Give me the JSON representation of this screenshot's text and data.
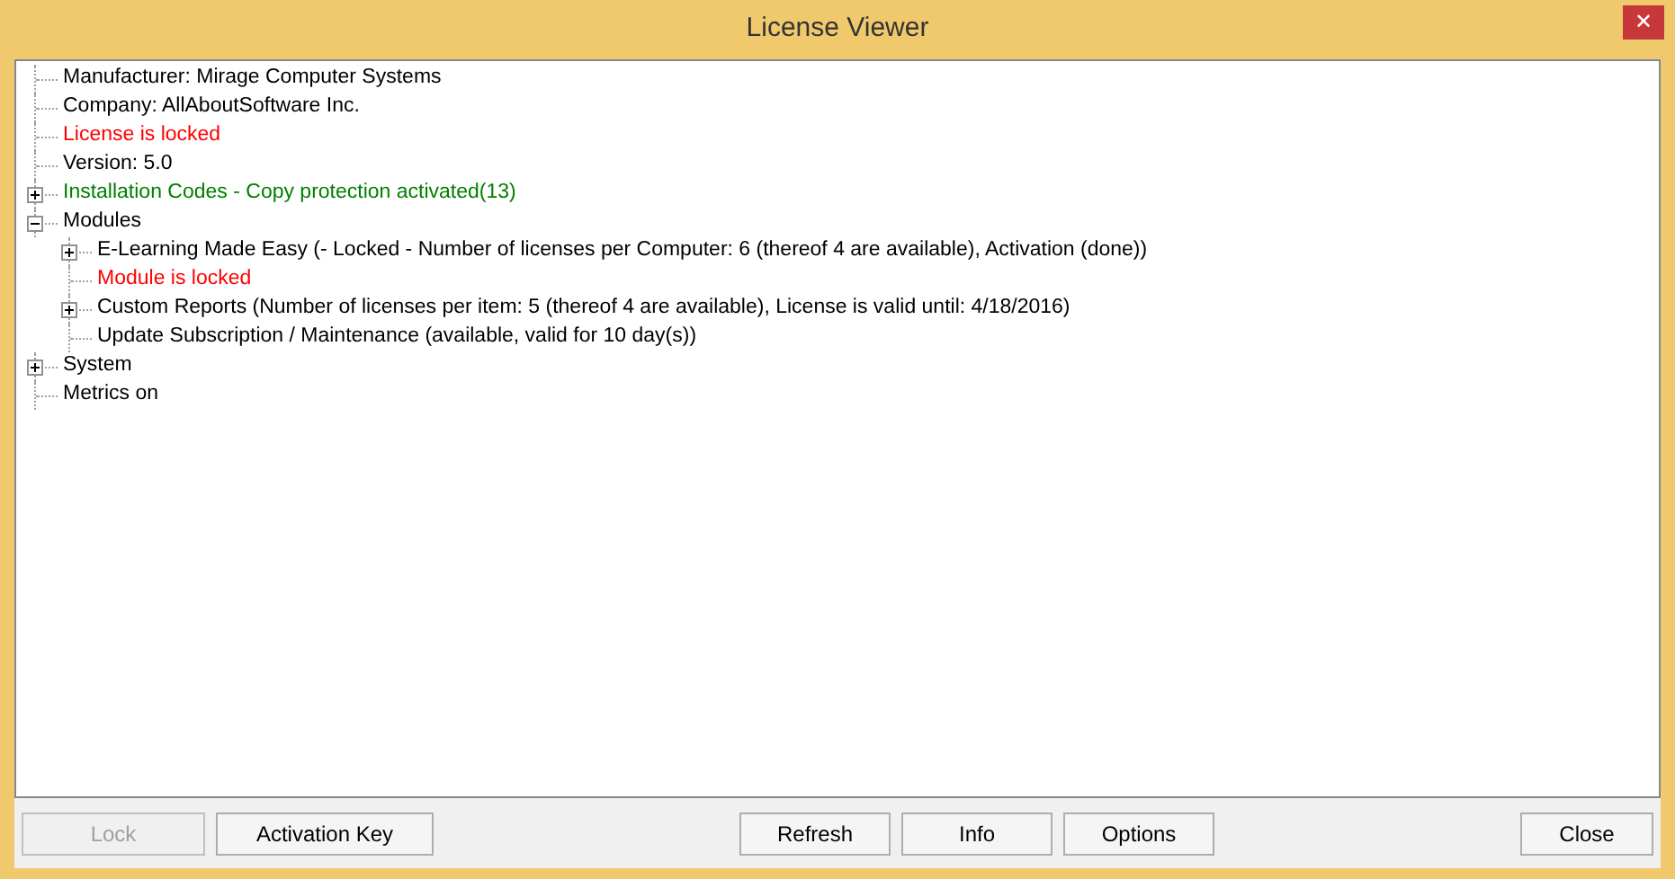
{
  "window": {
    "title": "License Viewer",
    "close_glyph": "✕"
  },
  "tree": [
    {
      "label": "Manufacturer: Mirage Computer Systems",
      "color": "#000000"
    },
    {
      "label": "Company: AllAboutSoftware Inc.",
      "color": "#000000"
    },
    {
      "label": "License is locked",
      "color": "#ff0000"
    },
    {
      "label": "Version: 5.0",
      "color": "#000000"
    },
    {
      "label": "Installation Codes - Copy protection activated(13)",
      "color": "#008000",
      "expanded": false
    },
    {
      "label": "Modules",
      "color": "#000000",
      "expanded": true,
      "children": [
        {
          "label": "E-Learning Made Easy (- Locked - Number of licenses per Computer: 6 (thereof 4 are available), Activation (done))",
          "color": "#000000",
          "expanded": false
        },
        {
          "label": "Module is locked",
          "color": "#ff0000"
        },
        {
          "label": "Custom Reports (Number of licenses per item: 5 (thereof 4 are available), License is valid until: 4/18/2016)",
          "color": "#000000",
          "expanded": false
        },
        {
          "label": "Update Subscription / Maintenance (available, valid for 10 day(s))",
          "color": "#000000"
        }
      ]
    },
    {
      "label": "System",
      "color": "#000000",
      "expanded": false
    },
    {
      "label": "Metrics on",
      "color": "#000000"
    }
  ],
  "button_groups": [
    [
      {
        "label": "Lock",
        "disabled": true
      },
      {
        "label": "Activation Key",
        "disabled": false
      }
    ],
    [
      {
        "label": "Refresh",
        "disabled": false
      },
      {
        "label": "Info",
        "disabled": false
      },
      {
        "label": "Options",
        "disabled": false
      }
    ],
    [
      {
        "label": "Close",
        "disabled": false
      }
    ]
  ]
}
